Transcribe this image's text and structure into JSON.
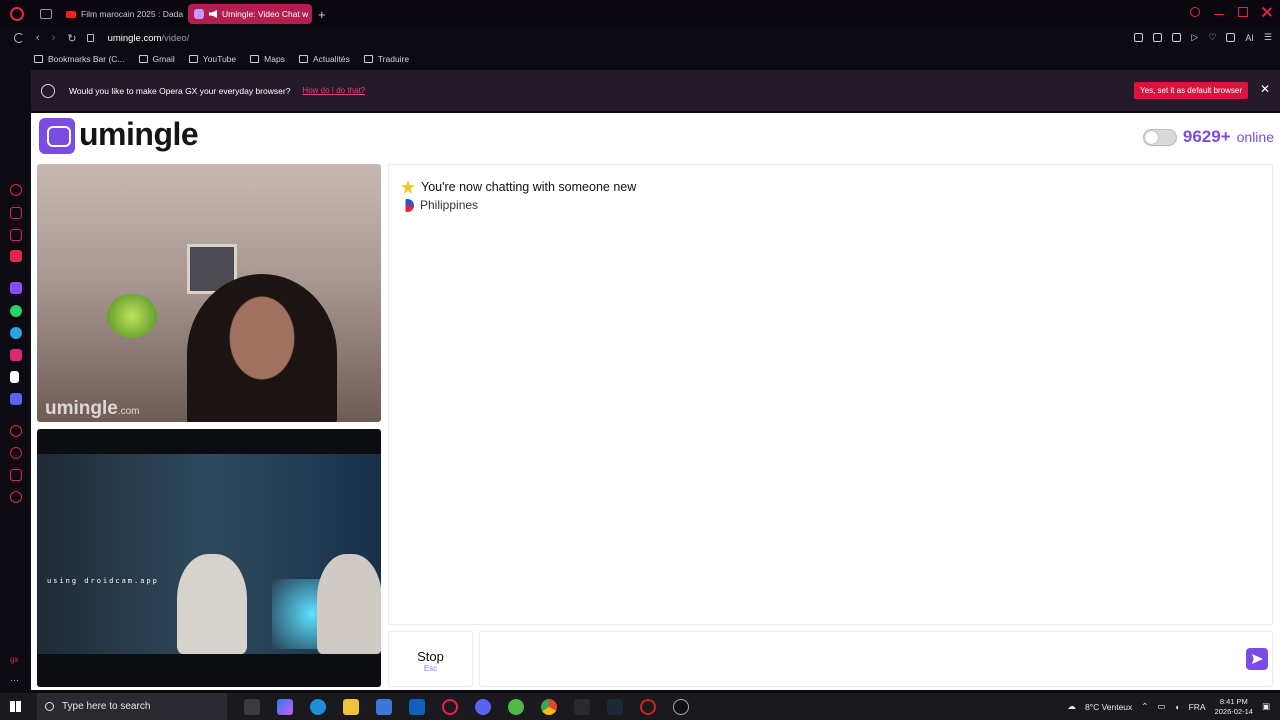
{
  "browser": {
    "tabs": [
      {
        "title": "Film marocain 2025 : Dada",
        "active": false
      },
      {
        "title": "Umingle: Video Chat w",
        "active": true
      }
    ],
    "new_tab": "+",
    "url_host": "umingle.com",
    "url_path": "/video/",
    "ai_label": "AI",
    "bookmarks": [
      "Bookmarks Bar (C...",
      "Gmail",
      "YouTube",
      "Maps",
      "Actualités",
      "Traduire"
    ]
  },
  "infobar": {
    "message": "Would you like to make Opera GX your everyday browser?",
    "link": "How do I do that?",
    "button": "Yes, set it as default browser",
    "close": "✕"
  },
  "site": {
    "name": "umingle",
    "online_count": "9629+",
    "online_label": "online",
    "watermark_main": "umingle",
    "watermark_suffix": ".com",
    "local_overlay": "using droidcam.app"
  },
  "chat": {
    "status_message": "You're now chatting with someone new",
    "partner_country": "Philippines",
    "stop_label": "Stop",
    "stop_shortcut": "Esc",
    "message_input": ""
  },
  "taskbar": {
    "search_placeholder": "Type here to search",
    "weather": "8°C  Venteux",
    "language": "FRA",
    "time": "8:41 PM",
    "date": "2026-02-14"
  },
  "colors": {
    "brand": "#7b4ce2",
    "opera_red": "#e3254a",
    "infobar_bg": "#241a2a",
    "default_button": "#d8153f"
  }
}
